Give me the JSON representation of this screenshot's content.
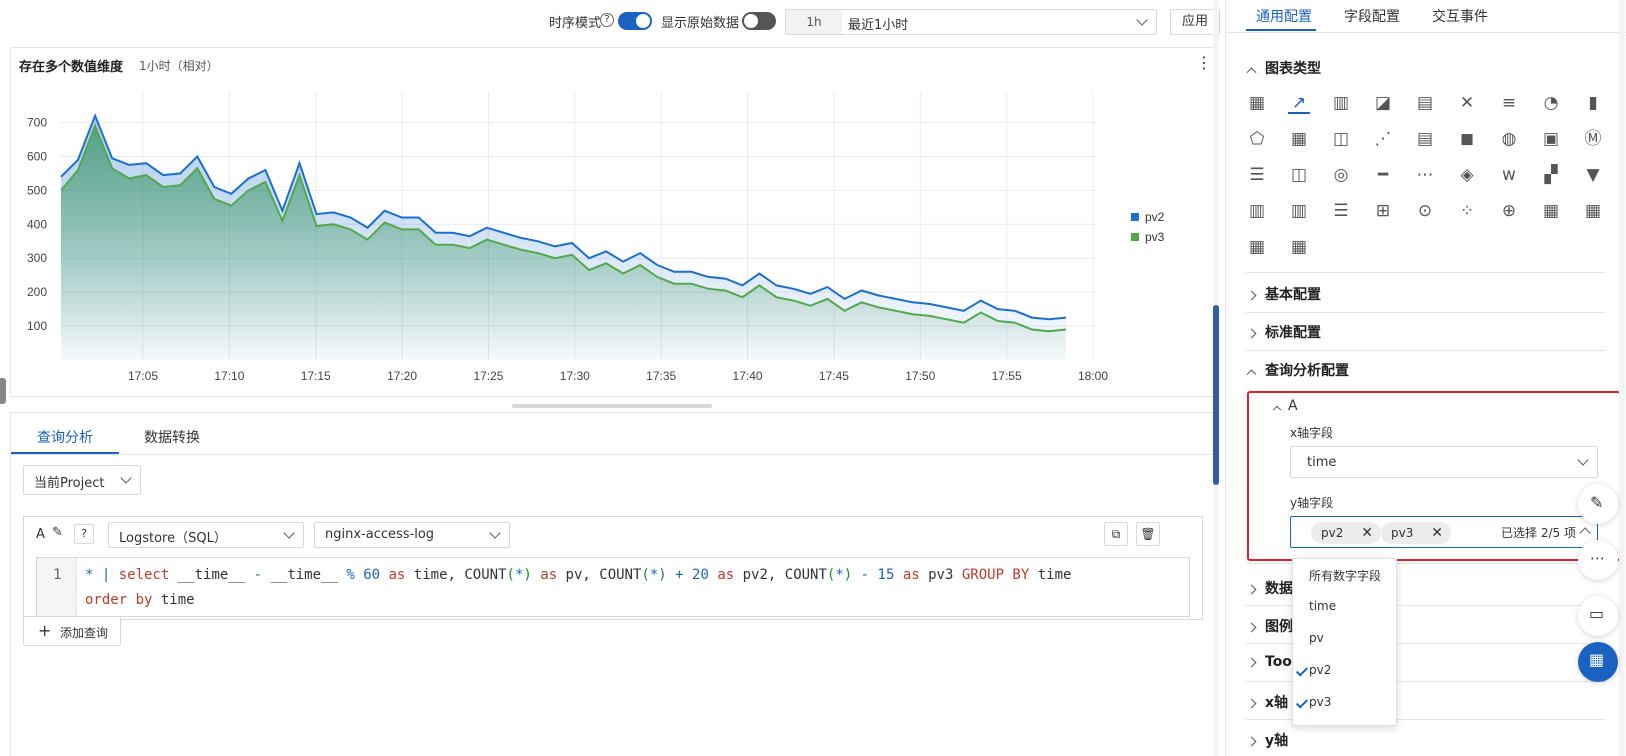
{
  "toolbar": {
    "timeseries_label": "时序模式",
    "raw_data_label": "显示原始数据",
    "time_short": "1h",
    "time_range": "最近1小时",
    "apply": "应用"
  },
  "chart": {
    "title": "存在多个数值维度",
    "subtitle": "1小时（相对）"
  },
  "chart_data": {
    "type": "area",
    "xlabels": [
      "17:05",
      "17:10",
      "17:15",
      "17:20",
      "17:25",
      "17:30",
      "17:35",
      "17:40",
      "17:45",
      "17:50",
      "17:55",
      "18:00"
    ],
    "yticks": [
      100,
      200,
      300,
      400,
      500,
      600,
      700
    ],
    "ylim": [
      0,
      790
    ],
    "grid": true,
    "legend_position": "right",
    "series": [
      {
        "name": "pv2",
        "color": "#1a6fd1",
        "values": [
          540,
          590,
          720,
          595,
          575,
          580,
          545,
          550,
          600,
          510,
          490,
          535,
          560,
          440,
          580,
          430,
          435,
          420,
          390,
          440,
          420,
          420,
          375,
          375,
          365,
          390,
          375,
          360,
          350,
          335,
          345,
          300,
          320,
          290,
          315,
          280,
          260,
          260,
          245,
          240,
          220,
          255,
          220,
          210,
          195,
          215,
          180,
          205,
          190,
          180,
          170,
          165,
          155,
          145,
          175,
          150,
          145,
          125,
          120,
          125
        ]
      },
      {
        "name": "pv3",
        "color": "#55a84a",
        "values": [
          500,
          560,
          690,
          565,
          535,
          545,
          510,
          515,
          565,
          475,
          455,
          500,
          525,
          410,
          545,
          395,
          400,
          385,
          355,
          405,
          385,
          385,
          340,
          340,
          330,
          355,
          340,
          325,
          315,
          300,
          310,
          265,
          285,
          255,
          280,
          245,
          225,
          225,
          210,
          205,
          185,
          220,
          185,
          175,
          160,
          180,
          145,
          170,
          155,
          145,
          135,
          130,
          120,
          110,
          140,
          115,
          110,
          90,
          85,
          90
        ]
      }
    ]
  },
  "query": {
    "tabs": [
      "查询分析",
      "数据转换"
    ],
    "project": "当前Project",
    "store_type": "Logstore（SQL）",
    "logstore": "nginx-access-log",
    "query_label": "A",
    "line_no": "1",
    "add_query": "添加查询"
  },
  "sidebar": {
    "tabs": [
      "通用配置",
      "字段配置",
      "交互事件"
    ],
    "chart_type_title": "图表类型",
    "sections": [
      "基本配置",
      "标准配置",
      "查询分析配置"
    ],
    "query_a": "A",
    "x_label": "x轴字段",
    "x_value": "time",
    "y_label": "y轴字段",
    "y_tags": [
      "pv2",
      "pv3"
    ],
    "y_count": "已选择 2/5 项",
    "more_sections": [
      "数据",
      "图例",
      "Tool",
      "x轴",
      "y轴"
    ],
    "dropdown": [
      "所有数字字段",
      "time",
      "pv",
      "pv2",
      "pv3"
    ]
  }
}
